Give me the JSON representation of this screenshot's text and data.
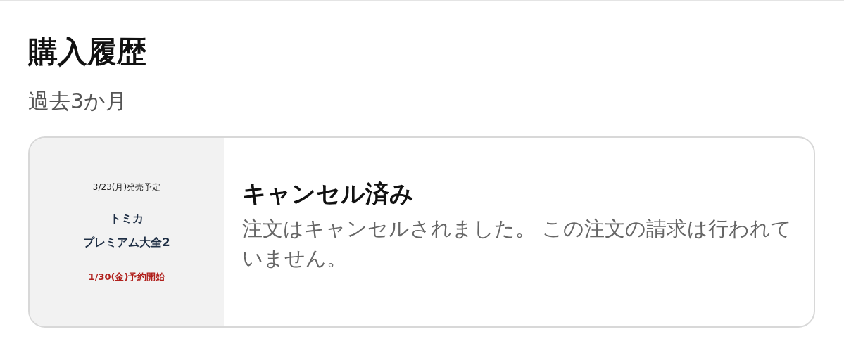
{
  "title": "購入履歴",
  "period": "過去3か月",
  "orders": [
    {
      "thumbnail": {
        "lines": [
          {
            "text": "3/23(月)発売予定",
            "kind": "date"
          },
          {
            "text": "トミカ",
            "kind": "name"
          },
          {
            "text": "プレミアム大全2",
            "kind": "name"
          },
          {
            "text": "1/30(金)予約開始",
            "kind": "notice"
          }
        ]
      },
      "status": "キャンセル済み",
      "message": "注文はキャンセルされました。 この注文の請求は行われていません。"
    }
  ]
}
